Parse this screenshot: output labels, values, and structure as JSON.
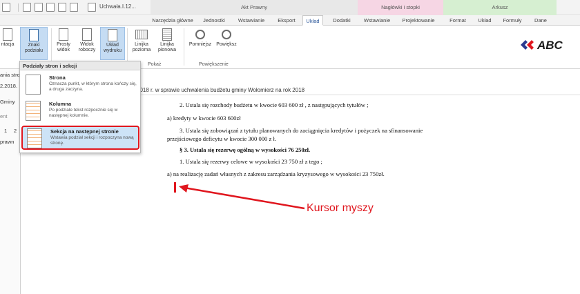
{
  "titlebar": {
    "doc_title": "Uchwała.I.12...",
    "context_groups": [
      {
        "label": "Akt Prawny",
        "color": "#e8e8e8"
      },
      {
        "label": "Nagłówki i stopki",
        "color": "#f6d6e4"
      },
      {
        "label": "Arkusz",
        "color": "#d6efd1"
      }
    ]
  },
  "tabs": [
    {
      "label": "Narzędzia główne"
    },
    {
      "label": "Jednostki"
    },
    {
      "label": "Wstawianie"
    },
    {
      "label": "Eksport"
    },
    {
      "label": "Układ",
      "active": true
    },
    {
      "label": "Dodatki"
    },
    {
      "label": "Wstawianie"
    },
    {
      "label": "Projektowanie"
    },
    {
      "label": "Format"
    },
    {
      "label": "Układ"
    },
    {
      "label": "Formuły"
    },
    {
      "label": "Dane"
    }
  ],
  "ribbon": {
    "orientation_label": "ntacja",
    "breaks_label": "Znaki podziału",
    "print_view_label": "Prosty widok",
    "draft_view_label": "Widok roboczy",
    "print_layout_label": "Układ wydruku",
    "h_ruler_label": "Linijka pozioma",
    "v_ruler_label": "Linijka pionowa",
    "zoom_out_label": "Pomniejsz",
    "zoom_in_label": "Powiększ",
    "show_group": "Pokaż",
    "zoom_group": "Powiększenie",
    "logo_text": "ABC"
  },
  "left_panel": {
    "l1": "ania stro",
    "l2": "2.2018.",
    "l3": "Gminy",
    "l4": "ent",
    "l5": "1",
    "l6": "2",
    "l7": "prawn"
  },
  "popup": {
    "header": "Podziały stron i sekcji",
    "items": [
      {
        "title": "Strona",
        "desc": "Oznacza punkt, w którym strona kończy się, a druga zaczyna."
      },
      {
        "title": "Kolumna",
        "desc": "Po podziale tekst rozpocznie się w następnej kolumnie."
      },
      {
        "title": "Sekcja na następnej stronie",
        "desc": "Wstawia podział sekcji i rozpoczyna nową stronę."
      }
    ]
  },
  "document": {
    "header": "2018 r. w sprawie uchwalenia budżetu gminy Wołomierz na rok 2018",
    "lines": [
      "2. Ustala się  rozchody budżetu w kwocie 603 600 zł , z następujących tytułów ;",
      "a) kredyty w kwocie 603 600zł",
      "3. Ustala się zobowiązań z tytułu planowanych do zaciągnięcia kredytów i pożyczek na  sfinansowanie",
      "przejściowego deficytu w kwocie 300 000 z ł.",
      "§ 3. Ustala się  rezerwę ogólną w wysokości 76 250zł.",
      "1. Ustala się  rezerwy celowe w wysokości 23 750 zł z tego ;",
      "a) na realizację zadań własnych z zakresu zarządzania kryzysowego w wysokości 23 750zł."
    ]
  },
  "annotation": {
    "text": "Kursor myszy",
    "color": "#e0161e"
  }
}
